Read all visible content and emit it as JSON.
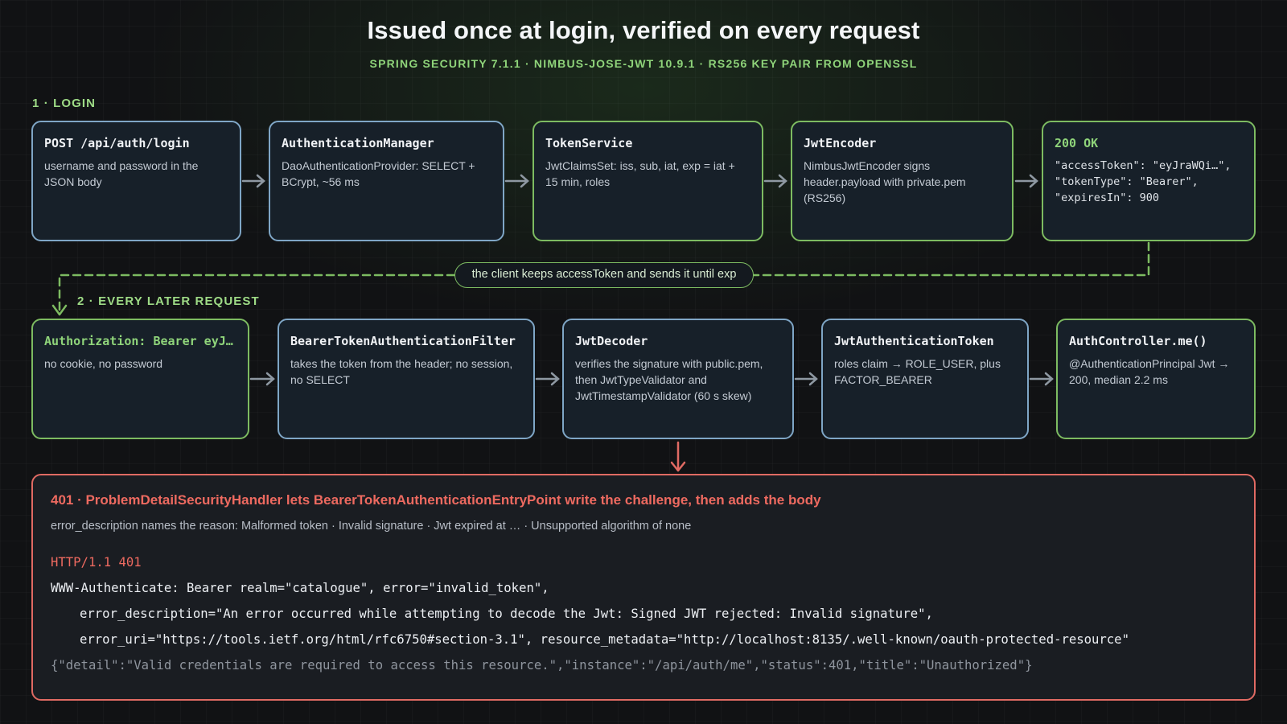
{
  "title": "Issued once at login, verified on every request",
  "subtitle": "SPRING SECURITY 7.1.1 · NIMBUS-JOSE-JWT 10.9.1 · RS256 KEY PAIR FROM OPENSSL",
  "login_section": {
    "label": "1 · LOGIN",
    "steps": [
      {
        "title": "POST /api/auth/login",
        "desc": "username and password in the JSON body"
      },
      {
        "title": "AuthenticationManager",
        "desc": "DaoAuthenticationProvider: SELECT + BCrypt, ~56 ms"
      },
      {
        "title": "TokenService",
        "desc": "JwtClaimsSet: iss, sub, iat, exp = iat + 15 min, roles"
      },
      {
        "title": "JwtEncoder",
        "desc": "NimbusJwtEncoder signs header.payload with private.pem (RS256)"
      },
      {
        "title": "200 OK",
        "code": [
          "\"accessToken\": \"eyJraWQi…\",",
          "\"tokenType\": \"Bearer\",",
          "\"expiresIn\": 900"
        ]
      }
    ]
  },
  "connector_label": "the client keeps accessToken and sends it until exp",
  "request_section": {
    "label": "2 · EVERY LATER REQUEST",
    "steps": [
      {
        "title": "Authorization: Bearer eyJ…",
        "desc": "no cookie, no password"
      },
      {
        "title": "BearerTokenAuthenticationFilter",
        "desc": "takes the token from the header; no session, no SELECT"
      },
      {
        "title": "JwtDecoder",
        "desc": "verifies the signature with public.pem, then JwtTypeValidator and JwtTimestampValidator (60 s skew)"
      },
      {
        "title": "JwtAuthenticationToken",
        "desc": "roles claim → ROLE_USER, plus FACTOR_BEARER"
      },
      {
        "title": "AuthController.me()",
        "desc": "@AuthenticationPrincipal Jwt → 200, median 2.2 ms"
      }
    ]
  },
  "error": {
    "title": "401 · ProblemDetailSecurityHandler lets BearerTokenAuthenticationEntryPoint write the challenge, then adds the body",
    "desc": "error_description names the reason: Malformed token · Invalid signature · Jwt expired at … · Unsupported algorithm of none",
    "status_line": "HTTP/1.1 401",
    "header_line1": "WWW-Authenticate: Bearer realm=\"catalogue\", error=\"invalid_token\",",
    "header_line2": "error_description=\"An error occurred while attempting to decode the Jwt: Signed JWT rejected: Invalid signature\",",
    "header_line3": "error_uri=\"https://tools.ietf.org/html/rfc6750#section-3.1\", resource_metadata=\"http://localhost:8135/.well-known/oauth-protected-resource\"",
    "body_line": "{\"detail\":\"Valid credentials are required to access this resource.\",\"instance\":\"/api/auth/me\",\"status\":401,\"title\":\"Unauthorized\"}"
  },
  "colors": {
    "background": "#111214",
    "card_fill": "#172029",
    "blue_border": "#7fa6c6",
    "green_border": "#7dbb61",
    "green_text": "#8fd47a",
    "error_red": "#e06a63",
    "arrow_gray": "#8e98a2"
  }
}
